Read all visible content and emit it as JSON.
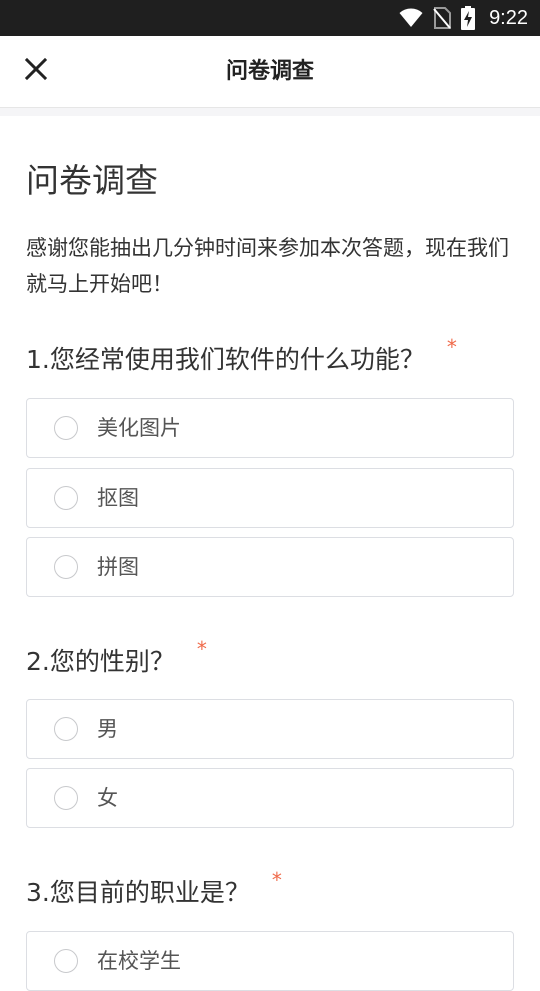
{
  "status_bar": {
    "time": "9:22",
    "icons": [
      "wifi-icon",
      "no-sim-icon",
      "battery-charging-icon"
    ]
  },
  "app_bar": {
    "title": "问卷调查",
    "close_icon": "close-icon"
  },
  "survey": {
    "title": "问卷调查",
    "description": "感谢您能抽出几分钟时间来参加本次答题，现在我们就马上开始吧！",
    "required_mark": "*",
    "questions": [
      {
        "title": "1.您经常使用我们软件的什么功能？",
        "required": true,
        "options": [
          "美化图片",
          "抠图",
          "拼图"
        ]
      },
      {
        "title": "2.您的性别？",
        "required": true,
        "options": [
          "男",
          "女"
        ]
      },
      {
        "title": "3.您目前的职业是？",
        "required": true,
        "options": [
          "在校学生"
        ]
      }
    ]
  },
  "colors": {
    "status_bar_bg": "#1f1f1f",
    "required_mark": "#f06a4a",
    "option_border": "#dcdee3",
    "text": "#333333"
  }
}
